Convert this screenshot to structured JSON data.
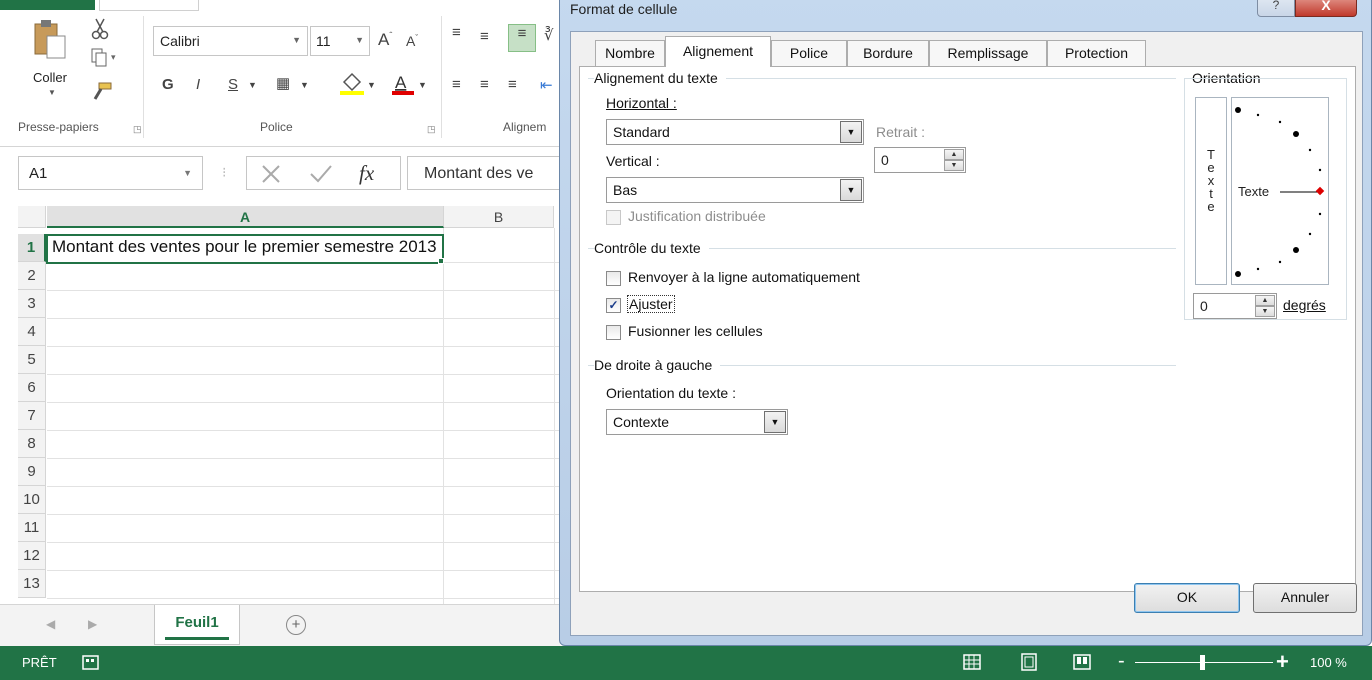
{
  "ribbon": {
    "clipboard": {
      "paste_label": "Coller",
      "group_label": "Presse-papiers"
    },
    "font": {
      "name": "Calibri",
      "size": "11",
      "grow": "A",
      "shrink": "A",
      "bold": "G",
      "italic": "I",
      "underline": "S",
      "group_label": "Police"
    },
    "alignment": {
      "group_label": "Alignem"
    }
  },
  "formula_bar": {
    "name_box": "A1",
    "fx": "fx",
    "content": "Montant des ve"
  },
  "grid": {
    "columns": [
      "A",
      "B"
    ],
    "rows": [
      "1",
      "2",
      "3",
      "4",
      "5",
      "6",
      "7",
      "8",
      "9",
      "10",
      "11",
      "12",
      "13"
    ],
    "a1": "Montant des ventes pour le premier semestre 2013"
  },
  "sheets": {
    "tabs": [
      "Feuil1"
    ],
    "add": "+"
  },
  "status": {
    "ready": "PRÊT",
    "zoom": "100 %",
    "minus": "-",
    "plus": "+"
  },
  "dialog": {
    "title": "Format de cellule",
    "help": "?",
    "close": "X",
    "tabs": [
      "Nombre",
      "Alignement",
      "Police",
      "Bordure",
      "Remplissage",
      "Protection"
    ],
    "active_tab": "Alignement",
    "text_alignment": {
      "title": "Alignement du texte",
      "horizontal_label": "Horizontal :",
      "horizontal_value": "Standard",
      "indent_label": "Retrait :",
      "indent_value": "0",
      "vertical_label": "Vertical :",
      "vertical_value": "Bas",
      "justify_distributed": "Justification distribuée"
    },
    "text_control": {
      "title": "Contrôle du texte",
      "wrap": "Renvoyer à la ligne automatiquement",
      "wrap_checked": false,
      "shrink": "Ajuster",
      "shrink_checked": true,
      "merge": "Fusionner les cellules",
      "merge_checked": false
    },
    "rtl": {
      "title": "De droite à gauche",
      "direction_label": "Orientation du texte :",
      "direction_value": "Contexte"
    },
    "orientation": {
      "title": "Orientation",
      "vertical_text": "T e x t e",
      "dial_text": "Texte",
      "degrees_value": "0",
      "degrees_label": "degrés"
    },
    "ok": "OK",
    "cancel": "Annuler"
  },
  "colors": {
    "excel_green": "#217346",
    "dialog_frame": "#c5d9ef",
    "close_red": "#c0392b"
  }
}
